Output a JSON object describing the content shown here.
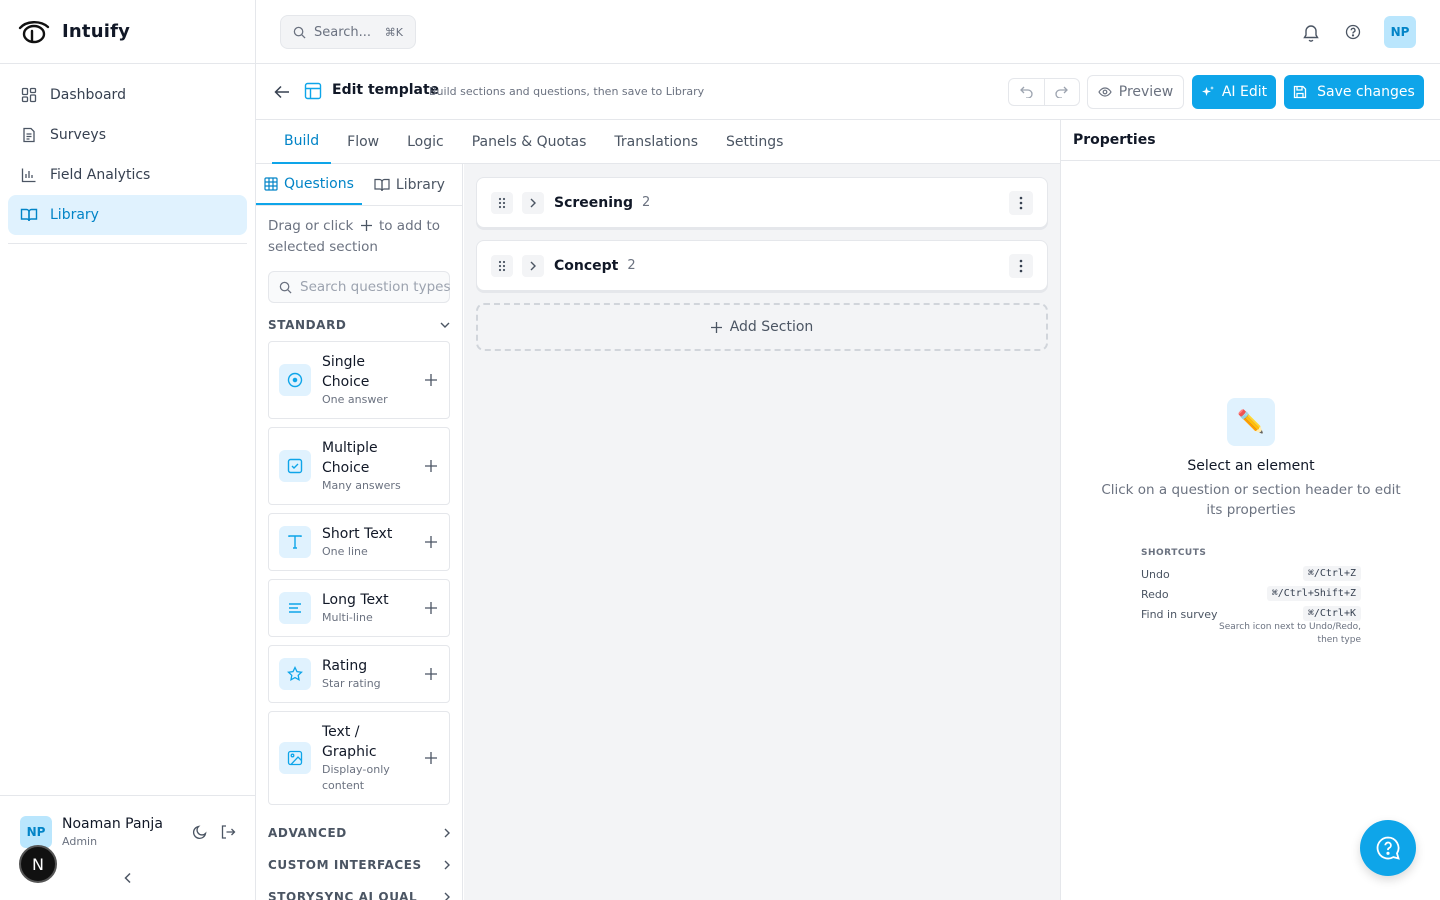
{
  "app": {
    "name": "Intuify"
  },
  "sidebar": {
    "items": [
      {
        "label": "Dashboard"
      },
      {
        "label": "Surveys"
      },
      {
        "label": "Field Analytics"
      },
      {
        "label": "Library"
      }
    ],
    "user": {
      "initials": "NP",
      "name": "Noaman Panja",
      "role": "Admin"
    },
    "n_badge": "N"
  },
  "topbar": {
    "search_label": "Search...",
    "search_shortcut": "⌘K",
    "avatar_initials": "NP"
  },
  "header": {
    "title": "Edit template",
    "subtitle": "Build sections and questions, then save to Library",
    "preview_label": "Preview",
    "ai_edit_label": "AI Edit",
    "save_label": "Save changes"
  },
  "tabs": [
    {
      "label": "Build"
    },
    {
      "label": "Flow"
    },
    {
      "label": "Logic"
    },
    {
      "label": "Panels & Quotas"
    },
    {
      "label": "Translations"
    },
    {
      "label": "Settings"
    }
  ],
  "palette": {
    "tab_questions": "Questions",
    "tab_library": "Library",
    "hint_before": "Drag or click",
    "hint_after": "to add to selected section",
    "search_placeholder": "Search question types",
    "groups": [
      {
        "label": "STANDARD"
      },
      {
        "label": "ADVANCED"
      },
      {
        "label": "CUSTOM INTERFACES"
      },
      {
        "label": "STORYSYNC AI QUAL"
      }
    ],
    "question_types": [
      {
        "name": "Single Choice",
        "desc": "One answer"
      },
      {
        "name": "Multiple Choice",
        "desc": "Many answers"
      },
      {
        "name": "Short Text",
        "desc": "One line"
      },
      {
        "name": "Long Text",
        "desc": "Multi-line"
      },
      {
        "name": "Rating",
        "desc": "Star rating"
      },
      {
        "name": "Text / Graphic",
        "desc": "Display-only content"
      }
    ]
  },
  "canvas": {
    "sections": [
      {
        "name": "Screening",
        "count": "2"
      },
      {
        "name": "Concept",
        "count": "2"
      }
    ],
    "add_section_label": "Add Section"
  },
  "properties": {
    "title": "Properties",
    "empty_title": "Select an element",
    "empty_desc": "Click on a question or section header to edit its properties",
    "shortcuts_title": "SHORTCUTS",
    "shortcuts": [
      {
        "label": "Undo",
        "key": "⌘/Ctrl+Z"
      },
      {
        "label": "Redo",
        "key": "⌘/Ctrl+Shift+Z"
      },
      {
        "label": "Find in survey",
        "key": "⌘/Ctrl+K",
        "note": "Search icon next to Undo/Redo, then type"
      }
    ]
  },
  "colors": {
    "accent": "#0ea5e9",
    "accent_dark": "#0284c7",
    "accent_light": "#e0f2fe"
  }
}
